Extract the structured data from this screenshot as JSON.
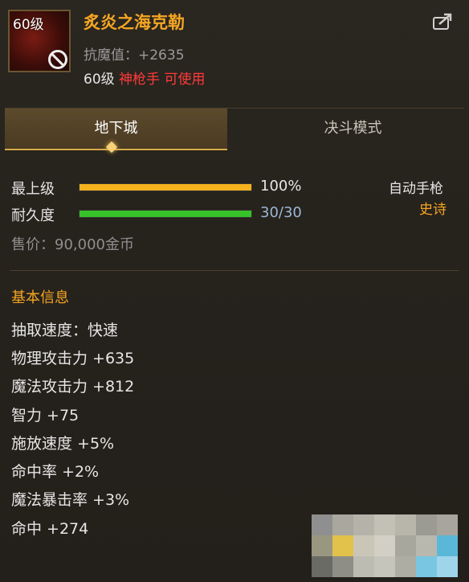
{
  "item": {
    "level_badge": "60级",
    "name": "炙炎之海克勒",
    "resist": "抗魔值：+2635",
    "req_level": "60级",
    "req_class": "神枪手 可使用"
  },
  "tabs": [
    {
      "label": "地下城",
      "active": true
    },
    {
      "label": "决斗模式",
      "active": false
    }
  ],
  "bars": {
    "grade": {
      "label": "最上级",
      "value": "100%",
      "fraction": 1.0,
      "color": "#f5b21e"
    },
    "durability": {
      "label": "耐久度",
      "value": "30/30",
      "fraction": 1.0,
      "color": "#38c22a"
    }
  },
  "weapon_type": "自动手枪",
  "rarity": "史诗",
  "price": "售价：90,000金币",
  "basic_info_title": "基本信息",
  "stats": [
    "抽取速度：快速",
    "物理攻击力 +635",
    "魔法攻击力 +812",
    "智力 +75",
    "施放速度 +5%",
    "命中率 +2%",
    "魔法暴击率 +3%",
    "命中 +274"
  ],
  "icons": [
    "ban-icon",
    "share-icon"
  ]
}
